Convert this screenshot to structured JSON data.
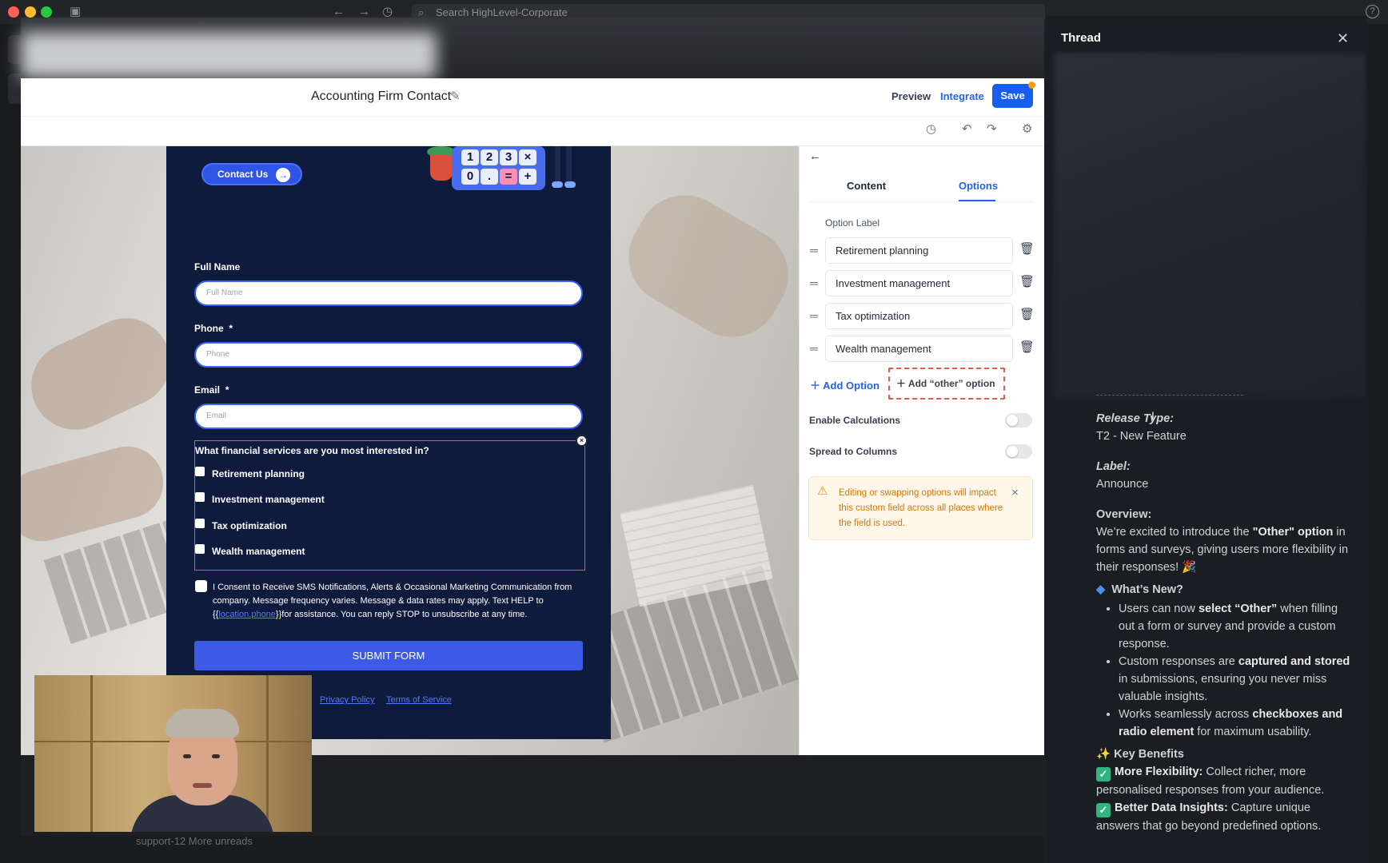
{
  "window": {
    "search_placeholder": "Search HighLevel-Corporate"
  },
  "builder": {
    "form_title": "Accounting Firm Contact",
    "preview_label": "Preview",
    "integrate_label": "Integrate",
    "save_label": "Save"
  },
  "form": {
    "contact_button": "Contact Us",
    "calculator_keys": [
      "1",
      "2",
      "3",
      "×",
      "0",
      ".",
      "=",
      "+"
    ],
    "full_name_label": "Full Name",
    "full_name_placeholder": "Full Name",
    "phone_label": "Phone",
    "phone_required": "*",
    "phone_placeholder": "Phone",
    "email_label": "Email",
    "email_required": "*",
    "email_placeholder": "Email",
    "question": "What financial services are you most interested in?",
    "options": [
      "Retirement planning",
      "Investment management",
      "Tax optimization",
      "Wealth management"
    ],
    "consent_before": "I Consent to Receive SMS Notifications, Alerts & Occasional Marketing Communication from company. Message frequency varies. Message & data rates may apply. Text HELP to {{",
    "consent_link": "location.phone",
    "consent_after": "}}for assistance. You can reply STOP to unsubscribe at any time.",
    "submit_label": "SUBMIT FORM",
    "privacy_link": "Privacy Policy",
    "terms_link": "Terms of Service"
  },
  "panel": {
    "tabs": [
      "Content",
      "Options"
    ],
    "active_tab": "Options",
    "option_label_heading": "Option Label",
    "options": [
      "Retirement planning",
      "Investment management",
      "Tax optimization",
      "Wealth management"
    ],
    "add_option": "Add Option",
    "add_other_option": "Add “other” option",
    "enable_calculations": "Enable Calculations",
    "enable_calculations_on": false,
    "spread_to_columns": "Spread to Columns",
    "spread_to_columns_on": false,
    "warning": "Editing or swapping options will impact this custom field across all places where the field is used."
  },
  "thread": {
    "title": "Thread",
    "release_type_key": "Release Type:",
    "release_type_value": "T2 - New Feature",
    "label_key": "Label:",
    "label_value": "Announce",
    "overview_key": "Overview:",
    "overview_1": "We’re excited to introduce the ",
    "overview_b": "\"Other\" option",
    "overview_2": " in forms and surveys, giving users more flexibility in their responses! 🎉",
    "whats_new": "What’s New?",
    "b1_a": "Users can now ",
    "b1_b": "select “Other”",
    "b1_c": " when filling out a form or survey and provide a custom response.",
    "b2_a": "Custom responses are ",
    "b2_b": "captured and stored",
    "b2_c": " in submissions, ensuring you never miss valuable insights.",
    "b3_a": "Works seamlessly across ",
    "b3_b": "checkboxes and radio element",
    "b3_c": " for maximum usability.",
    "key_benefits": "Key Benefits",
    "kb1_b": "More Flexibility:",
    "kb1_c": " Collect richer, more personalised responses from your audience.",
    "kb2_b": "Better Data Insights:",
    "kb2_c": " Capture unique answers that go beyond predefined options."
  },
  "background": {
    "bottom_text": "support-12     More unreads"
  },
  "colors": {
    "brand_blue": "#155eef",
    "form_bg": "#0f1b3d",
    "warning": "#d97706",
    "slack_bg": "#1a1d21"
  }
}
